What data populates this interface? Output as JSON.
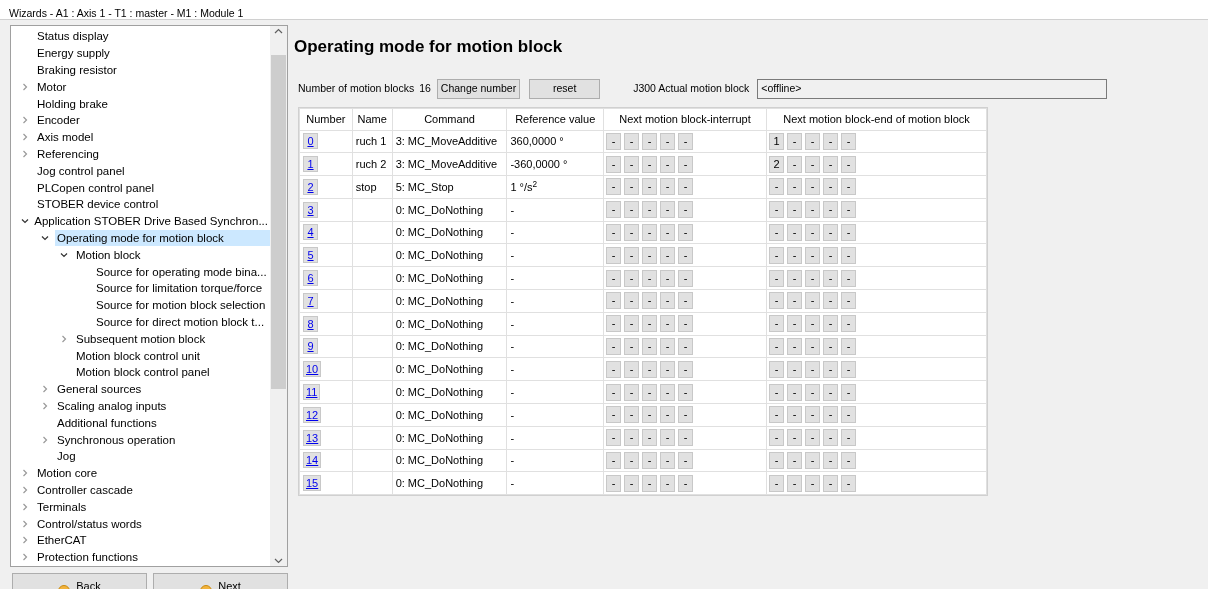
{
  "header": {
    "title": "Wizards - A1 : Axis 1 - T1 : master - M1 : Module 1"
  },
  "tree": [
    {
      "label": "Status display",
      "selected": false
    },
    {
      "label": "Energy supply",
      "selected": false
    },
    {
      "label": "Braking resistor",
      "selected": false
    },
    {
      "label": "Motor",
      "expanded": false,
      "selected": false
    },
    {
      "label": "Holding brake",
      "selected": false
    },
    {
      "label": "Encoder",
      "expanded": false,
      "selected": false
    },
    {
      "label": "Axis model",
      "expanded": false,
      "selected": false
    },
    {
      "label": "Referencing",
      "expanded": false,
      "selected": false
    },
    {
      "label": "Jog control panel",
      "selected": false
    },
    {
      "label": "PLCopen control panel",
      "selected": false
    },
    {
      "label": "STOBER device control",
      "selected": false
    },
    {
      "label": "Application STOBER Drive Based Synchron...",
      "expanded": true,
      "selected": false,
      "children": [
        {
          "label": "Operating mode for motion block",
          "expanded": true,
          "selected": true,
          "children": [
            {
              "label": "Motion block",
              "expanded": true,
              "selected": false,
              "children": [
                {
                  "label": "Source for operating mode bina...",
                  "selected": false
                },
                {
                  "label": "Source for limitation torque/force",
                  "selected": false
                },
                {
                  "label": "Source for motion block selection",
                  "selected": false
                },
                {
                  "label": "Source for direct motion block t...",
                  "selected": false
                }
              ]
            },
            {
              "label": "Subsequent motion block",
              "expanded": false,
              "selected": false
            },
            {
              "label": "Motion block control unit",
              "selected": false
            },
            {
              "label": "Motion block control panel",
              "selected": false
            }
          ]
        },
        {
          "label": "General sources",
          "expanded": false,
          "selected": false
        },
        {
          "label": "Scaling analog inputs",
          "expanded": false,
          "selected": false
        },
        {
          "label": "Additional functions",
          "selected": false
        },
        {
          "label": "Synchronous operation",
          "expanded": false,
          "selected": false
        },
        {
          "label": "Jog",
          "selected": false
        }
      ]
    },
    {
      "label": "Motion core",
      "expanded": false,
      "selected": false
    },
    {
      "label": "Controller cascade",
      "expanded": false,
      "selected": false
    },
    {
      "label": "Terminals",
      "expanded": false,
      "selected": false
    },
    {
      "label": "Control/status words",
      "expanded": false,
      "selected": false
    },
    {
      "label": "EtherCAT",
      "expanded": false,
      "selected": false
    },
    {
      "label": "Protection functions",
      "expanded": false,
      "selected": false
    }
  ],
  "nav_buttons": [
    "Back",
    "Next"
  ],
  "page_title": "Operating mode for motion block",
  "toolbar": {
    "count_label": "Number of motion blocks",
    "count": "16",
    "change_button": "Change number",
    "reset_button": "reset",
    "actual_label": "J300 Actual motion block",
    "actual_value": "<offline>"
  },
  "table": {
    "columns": [
      "Number",
      "Name",
      "Command",
      "Reference value",
      "Next motion block-interrupt",
      "Next motion block-end of motion block"
    ],
    "rows": [
      {
        "number": "0",
        "name": "ruch 1",
        "command": "3: MC_MoveAdditive",
        "reference": "360,0000 °",
        "interrupt": [
          "-",
          "-",
          "-",
          "-",
          "-"
        ],
        "end": [
          "1",
          "-",
          "-",
          "-",
          "-"
        ]
      },
      {
        "number": "1",
        "name": "ruch 2",
        "command": "3: MC_MoveAdditive",
        "reference": "-360,0000 °",
        "interrupt": [
          "-",
          "-",
          "-",
          "-",
          "-"
        ],
        "end": [
          "2",
          "-",
          "-",
          "-",
          "-"
        ]
      },
      {
        "number": "2",
        "name": "stop",
        "command": "5: MC_Stop",
        "reference": "1 °/s$^{2}$",
        "interrupt": [
          "-",
          "-",
          "-",
          "-",
          "-"
        ],
        "end": [
          "-",
          "-",
          "-",
          "-",
          "-"
        ]
      },
      {
        "number": "3",
        "command": "0: MC_DoNothing",
        "reference": "-",
        "interrupt": [
          "-",
          "-",
          "-",
          "-",
          "-"
        ],
        "end": [
          "-",
          "-",
          "-",
          "-",
          "-"
        ]
      },
      {
        "number": "4",
        "command": "0: MC_DoNothing",
        "reference": "-",
        "interrupt": [
          "-",
          "-",
          "-",
          "-",
          "-"
        ],
        "end": [
          "-",
          "-",
          "-",
          "-",
          "-"
        ]
      },
      {
        "number": "5",
        "command": "0: MC_DoNothing",
        "reference": "-",
        "interrupt": [
          "-",
          "-",
          "-",
          "-",
          "-"
        ],
        "end": [
          "-",
          "-",
          "-",
          "-",
          "-"
        ]
      },
      {
        "number": "6",
        "command": "0: MC_DoNothing",
        "reference": "-",
        "interrupt": [
          "-",
          "-",
          "-",
          "-",
          "-"
        ],
        "end": [
          "-",
          "-",
          "-",
          "-",
          "-"
        ]
      },
      {
        "number": "7",
        "command": "0: MC_DoNothing",
        "reference": "-",
        "interrupt": [
          "-",
          "-",
          "-",
          "-",
          "-"
        ],
        "end": [
          "-",
          "-",
          "-",
          "-",
          "-"
        ]
      },
      {
        "number": "8",
        "command": "0: MC_DoNothing",
        "reference": "-",
        "interrupt": [
          "-",
          "-",
          "-",
          "-",
          "-"
        ],
        "end": [
          "-",
          "-",
          "-",
          "-",
          "-"
        ]
      },
      {
        "number": "9",
        "command": "0: MC_DoNothing",
        "reference": "-",
        "interrupt": [
          "-",
          "-",
          "-",
          "-",
          "-"
        ],
        "end": [
          "-",
          "-",
          "-",
          "-",
          "-"
        ]
      },
      {
        "number": "10",
        "command": "0: MC_DoNothing",
        "reference": "-",
        "interrupt": [
          "-",
          "-",
          "-",
          "-",
          "-"
        ],
        "end": [
          "-",
          "-",
          "-",
          "-",
          "-"
        ]
      },
      {
        "number": "11",
        "command": "0: MC_DoNothing",
        "reference": "-",
        "interrupt": [
          "-",
          "-",
          "-",
          "-",
          "-"
        ],
        "end": [
          "-",
          "-",
          "-",
          "-",
          "-"
        ]
      },
      {
        "number": "12",
        "command": "0: MC_DoNothing",
        "reference": "-",
        "interrupt": [
          "-",
          "-",
          "-",
          "-",
          "-"
        ],
        "end": [
          "-",
          "-",
          "-",
          "-",
          "-"
        ]
      },
      {
        "number": "13",
        "command": "0: MC_DoNothing",
        "reference": "-",
        "interrupt": [
          "-",
          "-",
          "-",
          "-",
          "-"
        ],
        "end": [
          "-",
          "-",
          "-",
          "-",
          "-"
        ]
      },
      {
        "number": "14",
        "command": "0: MC_DoNothing",
        "reference": "-",
        "interrupt": [
          "-",
          "-",
          "-",
          "-",
          "-"
        ],
        "end": [
          "-",
          "-",
          "-",
          "-",
          "-"
        ]
      },
      {
        "number": "15",
        "command": "0: MC_DoNothing",
        "reference": "-",
        "interrupt": [
          "-",
          "-",
          "-",
          "-",
          "-"
        ],
        "end": [
          "-",
          "-",
          "-",
          "-",
          "-"
        ]
      }
    ]
  }
}
